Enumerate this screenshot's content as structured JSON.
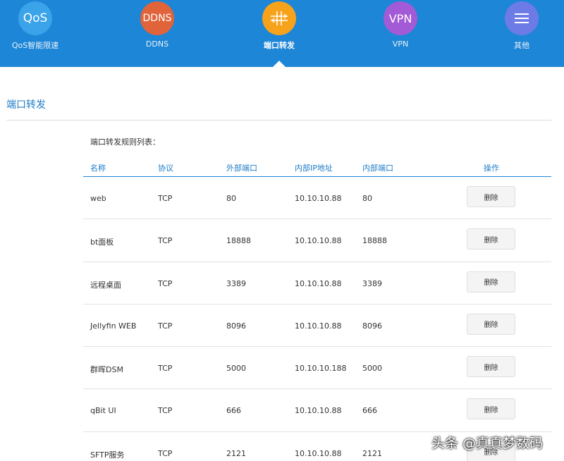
{
  "nav": {
    "items": [
      {
        "label": "QoS智能限速",
        "icon_text": "QoS",
        "icon": "qos-icon",
        "color": "#3aa3ea"
      },
      {
        "label": "DDNS",
        "icon_text": "DDNS",
        "icon": "ddns-icon",
        "color": "#e0633a"
      },
      {
        "label": "端口转发",
        "icon_text": "",
        "icon": "port-forward-icon",
        "color": "#f7a21b",
        "active": true
      },
      {
        "label": "VPN",
        "icon_text": "VPN",
        "icon": "vpn-icon",
        "color": "#a35ad6"
      },
      {
        "label": "其他",
        "icon_text": "",
        "icon": "menu-icon",
        "color": "#6d7be6"
      }
    ]
  },
  "page": {
    "section_title": "端口转发",
    "list_caption": "端口转发规则列表："
  },
  "table": {
    "headers": {
      "name": "名称",
      "protocol": "协议",
      "external_port": "外部端口",
      "internal_ip": "内部IP地址",
      "internal_port": "内部端口",
      "action": "操作"
    },
    "rows": [
      {
        "name": "web",
        "protocol": "TCP",
        "external_port": "80",
        "internal_ip": "10.10.10.88",
        "internal_port": "80",
        "action": "删除"
      },
      {
        "name": "bt面板",
        "protocol": "TCP",
        "external_port": "18888",
        "internal_ip": "10.10.10.88",
        "internal_port": "18888",
        "action": "删除"
      },
      {
        "name": "远程桌面",
        "protocol": "TCP",
        "external_port": "3389",
        "internal_ip": "10.10.10.88",
        "internal_port": "3389",
        "action": "删除"
      },
      {
        "name": "Jellyfin WEB",
        "protocol": "TCP",
        "external_port": "8096",
        "internal_ip": "10.10.10.88",
        "internal_port": "8096",
        "action": "删除"
      },
      {
        "name": "群晖DSM",
        "protocol": "TCP",
        "external_port": "5000",
        "internal_ip": "10.10.10.188",
        "internal_port": "5000",
        "action": "删除"
      },
      {
        "name": "qBit UI",
        "protocol": "TCP",
        "external_port": "666",
        "internal_ip": "10.10.10.88",
        "internal_port": "666",
        "action": "删除"
      },
      {
        "name": "SFTP服务",
        "protocol": "TCP",
        "external_port": "2121",
        "internal_ip": "10.10.10.88",
        "internal_port": "2121",
        "action": "删除"
      }
    ]
  },
  "watermark": "头条 @真真梦数码"
}
